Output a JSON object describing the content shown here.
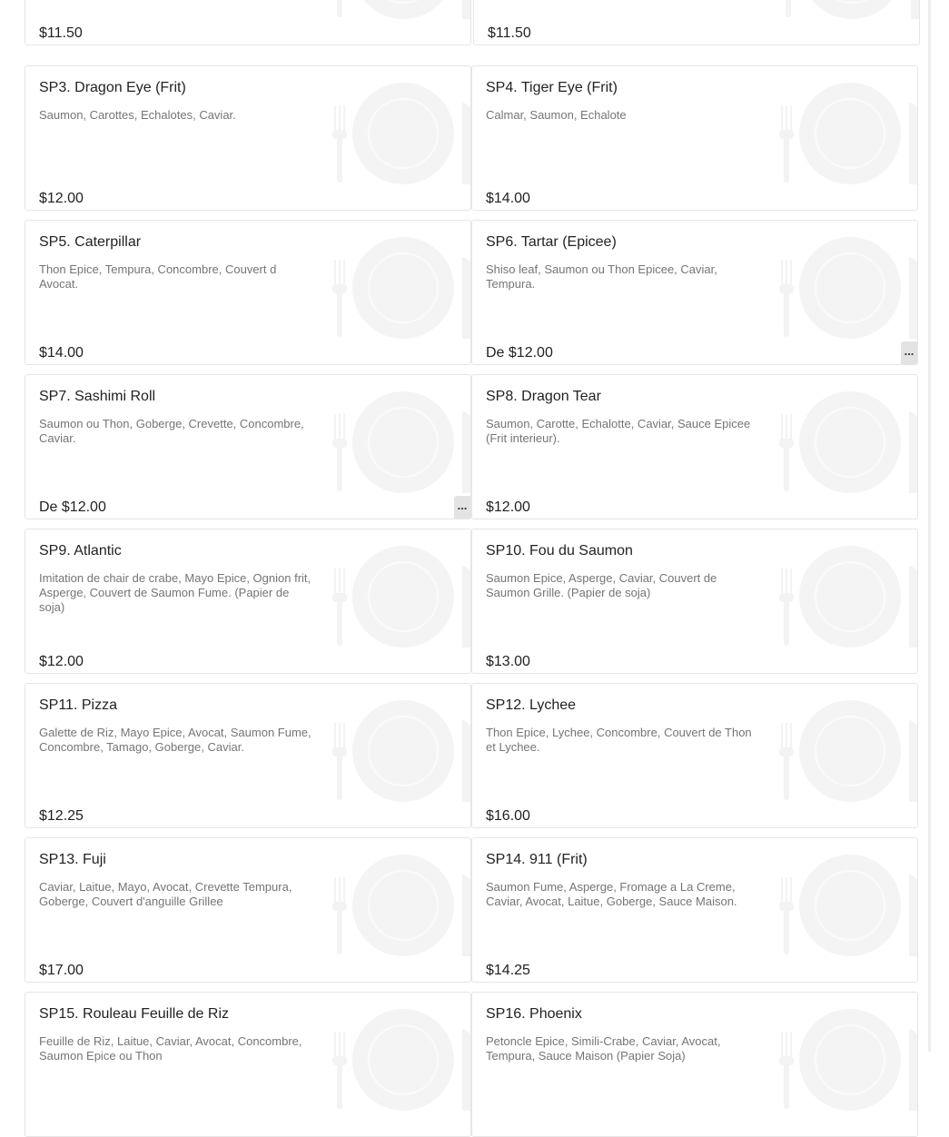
{
  "items": [
    {
      "name": "",
      "description": "",
      "price": "$11.50",
      "has_more": false
    },
    {
      "name": "",
      "description": "",
      "price": "$11.50",
      "has_more": false
    },
    {
      "name": "SP3. Dragon Eye (Frit)",
      "description": "Saumon, Carottes, Echalotes, Caviar.",
      "price": "$12.00",
      "has_more": false
    },
    {
      "name": "SP4. Tiger Eye (Frit)",
      "description": "Calmar, Saumon, Echalote",
      "price": "$14.00",
      "has_more": false
    },
    {
      "name": "SP5. Caterpillar",
      "description": "Thon Epice, Tempura, Concombre, Couvert d Avocat.",
      "price": "$14.00",
      "has_more": false
    },
    {
      "name": "SP6. Tartar (Epicee)",
      "description": "Shiso leaf, Saumon ou Thon Epicee, Caviar, Tempura.",
      "price": "De $12.00",
      "has_more": true
    },
    {
      "name": "SP7. Sashimi Roll",
      "description": "Saumon ou Thon, Goberge, Crevette, Concombre, Caviar.",
      "price": "De $12.00",
      "has_more": true
    },
    {
      "name": "SP8. Dragon Tear",
      "description": "Saumon, Carotte, Echalotte, Caviar, Sauce Epicee (Frit interieur).",
      "price": "$12.00",
      "has_more": false
    },
    {
      "name": "SP9. Atlantic",
      "description": "Imitation de chair de crabe, Mayo Epice, Ognion frit, Asperge, Couvert de Saumon Fume. (Papier de soja)",
      "price": "$12.00",
      "has_more": false
    },
    {
      "name": "SP10. Fou du Saumon",
      "description": "Saumon Epice, Asperge, Caviar, Couvert de Saumon Grille. (Papier de soja)",
      "price": "$13.00",
      "has_more": false
    },
    {
      "name": "SP11. Pizza",
      "description": "Galette de Riz, Mayo Epice, Avocat, Saumon Fume, Concombre, Tamago, Goberge, Caviar.",
      "price": "$12.25",
      "has_more": false
    },
    {
      "name": "SP12. Lychee",
      "description": "Thon Epice, Lychee, Concombre, Couvert de Thon et Lychee.",
      "price": "$16.00",
      "has_more": false
    },
    {
      "name": "SP13. Fuji",
      "description": "Caviar, Laitue, Mayo, Avocat, Crevette Tempura, Goberge, Couvert d'anguille Grillee",
      "price": "$17.00",
      "has_more": false
    },
    {
      "name": "SP14. 911 (Frit)",
      "description": "Saumon Fume, Asperge, Fromage a La Creme, Caviar, Avocat, Laitue, Goberge, Sauce Maison.",
      "price": "$14.25",
      "has_more": false
    },
    {
      "name": "SP15. Rouleau Feuille de Riz",
      "description": "Feuille de Riz, Laitue, Caviar, Avocat, Concombre, Saumon Epice ou Thon",
      "price": "",
      "has_more": false
    },
    {
      "name": "SP16. Phoenix",
      "description": "Petoncle Epice, Simili-Crabe, Caviar, Avocat, Tempura, Sauce Maison (Papier Soja)",
      "price": "",
      "has_more": false
    }
  ],
  "more_label": "...",
  "icons": {
    "placeholder": "plate-fork-knife-icon"
  },
  "colors": {
    "placeholder": "#f4f4f4",
    "border": "#e6e6e6",
    "desc": "#757575"
  }
}
